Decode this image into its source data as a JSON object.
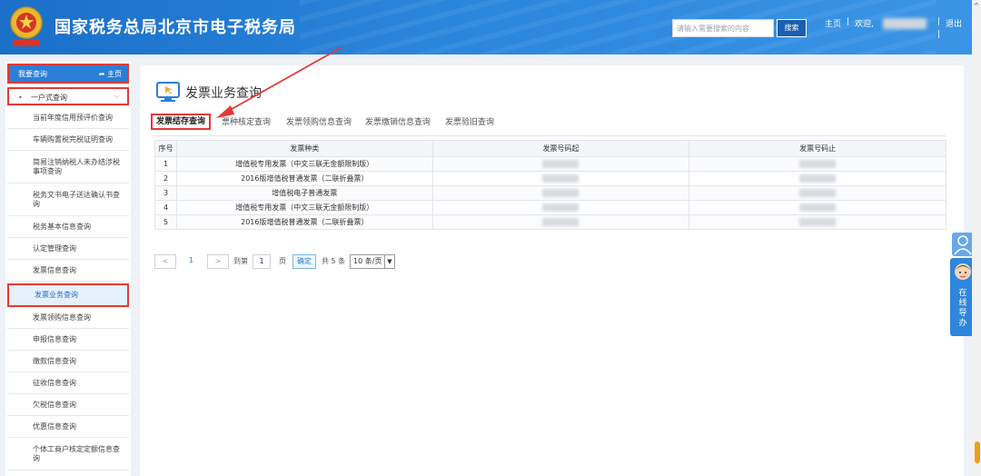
{
  "header": {
    "title": "国家税务总局北京市电子税务局",
    "search_placeholder": "请输入需要搜索的内容",
    "search_button": "搜索",
    "home_link": "主页",
    "separator": "|",
    "welcome": "欢迎,",
    "logout": "退出"
  },
  "sidebar": {
    "top_label": "我要查询",
    "top_home": "主页",
    "group_label": "一户式查询",
    "items": [
      {
        "label": "当前年度信用预评价查询"
      },
      {
        "label": "车辆购置税完税证明查询"
      },
      {
        "label": "简易注销纳税人未办结涉税事项查询"
      },
      {
        "label": "税务文书电子送达确认书查询"
      },
      {
        "label": "税务基本信息查询"
      },
      {
        "label": "认定管理查询"
      },
      {
        "label": "发票信息查询"
      },
      {
        "label": "发票业务查询"
      },
      {
        "label": "发票领购信息查询"
      },
      {
        "label": "申报信息查询"
      },
      {
        "label": "缴款信息查询"
      },
      {
        "label": "征收信息查询"
      },
      {
        "label": "欠税信息查询"
      },
      {
        "label": "优惠信息查询"
      },
      {
        "label": "个体工商户核定定额信息查询"
      }
    ]
  },
  "main": {
    "page_title": "发票业务查询",
    "tabs": [
      {
        "label": "发票结存查询"
      },
      {
        "label": "票种核定查询"
      },
      {
        "label": "发票领购信息查询"
      },
      {
        "label": "发票缴销信息查询"
      },
      {
        "label": "发票验旧查询"
      }
    ],
    "table": {
      "headers": [
        "序号",
        "发票种类",
        "发票号码起",
        "发票号码止"
      ],
      "rows": [
        {
          "no": "1",
          "type": "增值税专用发票（中文三联无金额限制版）"
        },
        {
          "no": "2",
          "type": "2016版增值税普通发票（二联折叠票）"
        },
        {
          "no": "3",
          "type": "增值税电子普通发票"
        },
        {
          "no": "4",
          "type": "增值税专用发票（中文三联无金额限制版）"
        },
        {
          "no": "5",
          "type": "2016版增值税普通发票（二联折叠票）"
        }
      ]
    },
    "pager": {
      "prev": "<",
      "current_page": "1",
      "next": ">",
      "goto_label": "到第",
      "goto_value": "1",
      "page_unit": "页",
      "ok": "确定",
      "total": "共 5 条",
      "page_size": "10 条/页"
    }
  },
  "float": {
    "help_text": "在线导办"
  },
  "colors": {
    "header_blue": "#2a86dc",
    "highlight_red": "#e53935",
    "sidebar_active": "#2b7fd6"
  }
}
